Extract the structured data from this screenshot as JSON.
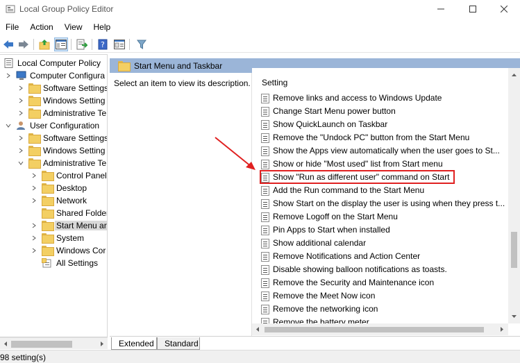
{
  "window": {
    "title": "Local Group Policy Editor"
  },
  "menu": {
    "file": "File",
    "action": "Action",
    "view": "View",
    "help": "Help"
  },
  "tree": {
    "root": "Local Computer Policy",
    "computer_config": "Computer Configura",
    "cc_software": "Software Settings",
    "cc_windows": "Windows Setting",
    "cc_admin": "Administrative Te",
    "user_config": "User Configuration",
    "uc_software": "Software Settings",
    "uc_windows": "Windows Setting",
    "uc_admin": "Administrative Te",
    "control_panel": "Control Panel",
    "desktop": "Desktop",
    "network": "Network",
    "shared_folders": "Shared Folder",
    "start_menu": "Start Menu ar",
    "system": "System",
    "windows_components": "Windows Cor",
    "all_settings": "All Settings"
  },
  "panel": {
    "header": "Start Menu and Taskbar",
    "description": "Select an item to view its description.",
    "column_header": "Setting"
  },
  "settings": [
    "Remove links and access to Windows Update",
    "Change Start Menu power button",
    "Show QuickLaunch on Taskbar",
    "Remove the \"Undock PC\" button from the Start Menu",
    "Show the Apps view automatically when the user goes to St...",
    "Show or hide \"Most used\" list from Start menu",
    "Show \"Run as different user\" command on Start",
    "Add the Run command to the Start Menu",
    "Show Start on the display the user is using when they press t...",
    "Remove Logoff on the Start Menu",
    "Pin Apps to Start when installed",
    "Show additional calendar",
    "Remove Notifications and Action Center",
    "Disable showing balloon notifications as toasts.",
    "Remove the Security and Maintenance icon",
    "Remove the Meet Now icon",
    "Remove the networking icon",
    "Remove the battery meter"
  ],
  "tabs": {
    "extended": "Extended",
    "standard": "Standard"
  },
  "status": {
    "text": "98 setting(s)"
  },
  "colors": {
    "header_bg": "#9bb5d8",
    "highlight": "#e02020",
    "arrow": "#e02020"
  }
}
